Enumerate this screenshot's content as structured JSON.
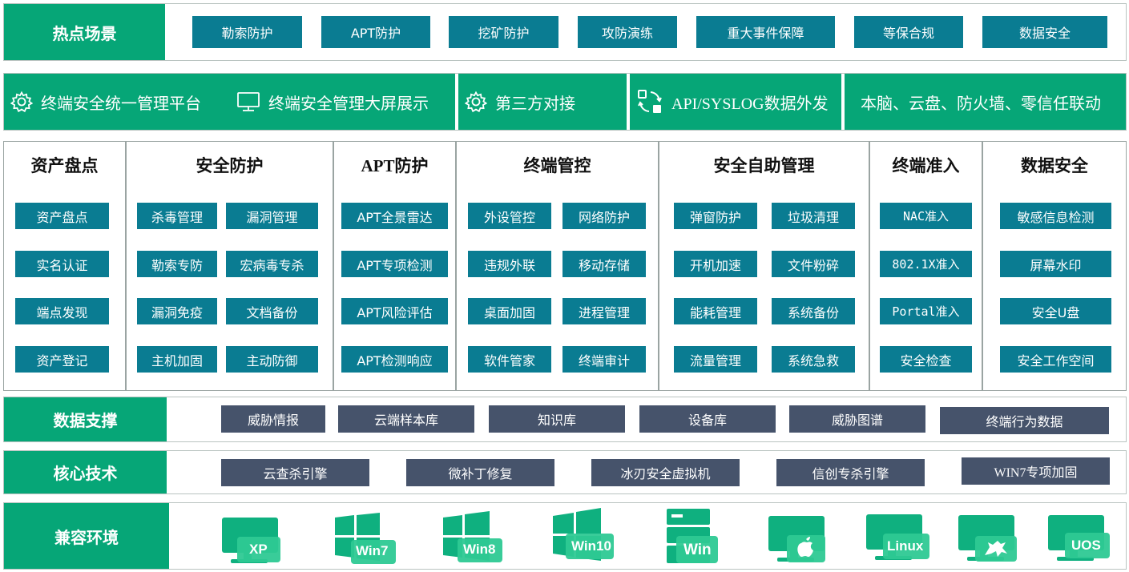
{
  "hot_scenes": {
    "label": "热点场景",
    "items": [
      "勒索防护",
      "APT防护",
      "挖矿防护",
      "攻防演练",
      "重大事件保障",
      "等保合规",
      "数据安全"
    ]
  },
  "features": [
    {
      "icon": "gear-icon",
      "label": "终端安全统一管理平台"
    },
    {
      "icon": "monitor-icon",
      "label": "终端安全管理大屏展示"
    },
    {
      "icon": "gear-icon",
      "label": "第三方对接"
    },
    {
      "icon": "sync-icon",
      "label": "API/SYSLOG数据外发"
    },
    {
      "icon": "",
      "label": "本脑、云盘、防火墙、零信任联动"
    }
  ],
  "modules": [
    {
      "title": "资产盘点",
      "items": [
        "资产盘点",
        "实名认证",
        "端点发现",
        "资产登记"
      ]
    },
    {
      "title": "安全防护",
      "items": [
        "杀毒管理",
        "漏洞管理",
        "勒索专防",
        "宏病毒专杀",
        "漏洞免疫",
        "文档备份",
        "主机加固",
        "主动防御"
      ]
    },
    {
      "title": "APT防护",
      "items": [
        "APT全景雷达",
        "APT专项检测",
        "APT风险评估",
        "APT检测响应"
      ]
    },
    {
      "title": "终端管控",
      "items": [
        "外设管控",
        "网络防护",
        "违规外联",
        "移动存储",
        "桌面加固",
        "进程管理",
        "软件管家",
        "终端审计"
      ]
    },
    {
      "title": "安全自助管理",
      "items": [
        "弹窗防护",
        "垃圾清理",
        "开机加速",
        "文件粉碎",
        "能耗管理",
        "系统备份",
        "流量管理",
        "系统急救"
      ]
    },
    {
      "title": "终端准入",
      "items": [
        "NAC准入",
        "802.1X准入",
        "Portal准入",
        "安全检查"
      ]
    },
    {
      "title": "数据安全",
      "items": [
        "敏感信息检测",
        "屏幕水印",
        "安全U盘",
        "安全工作空间"
      ]
    }
  ],
  "data_support": {
    "label": "数据支撑",
    "items": [
      "威胁情报",
      "云端样本库",
      "知识库",
      "设备库",
      "威胁图谱",
      "终端行为数据"
    ]
  },
  "core_tech": {
    "label": "核心技术",
    "items": [
      "云查杀引擎",
      "微补丁修复",
      "冰刃安全虚拟机",
      "信创专杀引擎",
      "WIN7专项加固"
    ]
  },
  "compat": {
    "label": "兼容环境",
    "items": [
      {
        "icon": "xp-monitor-icon",
        "label": "XP"
      },
      {
        "icon": "windows-logo-icon",
        "label": "Win7"
      },
      {
        "icon": "windows-logo-icon",
        "label": "Win8"
      },
      {
        "icon": "windows-logo-icon",
        "label": "Win10"
      },
      {
        "icon": "server-icon",
        "label": "Win"
      },
      {
        "icon": "apple-logo-icon",
        "label": ""
      },
      {
        "icon": "linux-monitor-icon",
        "label": "Linux"
      },
      {
        "icon": "kylin-monitor-icon",
        "label": ""
      },
      {
        "icon": "uos-monitor-icon",
        "label": "UOS"
      }
    ]
  },
  "colors": {
    "green": "#06a677",
    "teal": "#0a7c92",
    "slate": "#46536b"
  }
}
